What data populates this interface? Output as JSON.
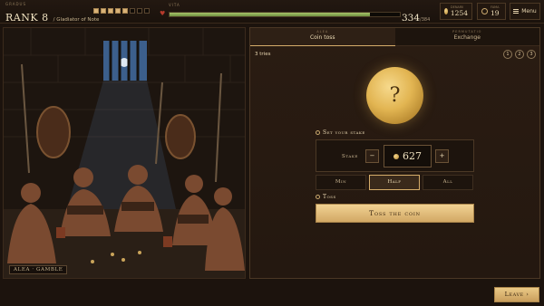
{
  "header": {
    "rank_caption": "GRADUS",
    "rank_title": "RANK 8",
    "rank_subtitle": "/ Gladiator of Note",
    "rank_progress": {
      "filled": 5,
      "total": 8
    },
    "vita_caption": "VITA",
    "vita_current": "334",
    "vita_max": "/384",
    "vita_fraction": 0.87,
    "gold_caption": "DENARII",
    "gold_value": "1254",
    "fame_caption": "FAMA",
    "fame_value": "19",
    "menu_label": "Menu"
  },
  "scene": {
    "tag": "ALEA · GAMBLE"
  },
  "tabs": [
    {
      "caption": "ALEA",
      "label": "Coin toss",
      "active": true
    },
    {
      "caption": "PERMUTATIO",
      "label": "Exchange",
      "active": false
    }
  ],
  "game": {
    "tries_label": "3 tries",
    "try_steps": [
      "1",
      "2",
      "3"
    ],
    "coin_symbol": "?",
    "stake_section_label": "Set your stake",
    "stake_label": "Stake",
    "minus_label": "−",
    "plus_label": "+",
    "stake_value": "627",
    "presets": [
      {
        "label": "Min",
        "active": false
      },
      {
        "label": "Half",
        "active": true
      },
      {
        "label": "All",
        "active": false
      }
    ],
    "toss_section_label": "Toss",
    "toss_button": "Toss the coin"
  },
  "footer": {
    "leave_button": "Leave ›"
  },
  "colors": {
    "background": "#1c130d",
    "gold_accent": "#d6ad6a",
    "vita_bar": "#8fb055",
    "heart": "#b63a2c"
  },
  "icons": [
    "heart-icon",
    "coin-icon",
    "laurel-icon",
    "menu-icon",
    "question-coin-icon"
  ]
}
